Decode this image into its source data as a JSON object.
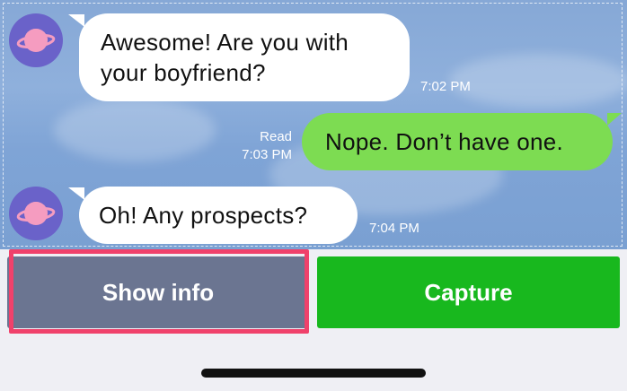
{
  "messages": [
    {
      "direction": "in",
      "lines": [
        "Awesome! Are you with",
        "your boyfriend?"
      ],
      "time": "7:02 PM"
    },
    {
      "direction": "out",
      "text": "Nope. Don’t have one.",
      "read": "Read",
      "time": "7:03 PM"
    },
    {
      "direction": "in",
      "text": "Oh! Any prospects?",
      "time": "7:04 PM"
    }
  ],
  "avatar_icon": "planet-icon",
  "buttons": {
    "show_info": "Show info",
    "capture": "Capture"
  },
  "colors": {
    "incoming_bubble": "#ffffff",
    "outgoing_bubble": "#7ddc52",
    "show_info_button": "#6b7591",
    "capture_button": "#18b81e",
    "highlight": "#f0416b",
    "avatar": "#6a62c9"
  }
}
